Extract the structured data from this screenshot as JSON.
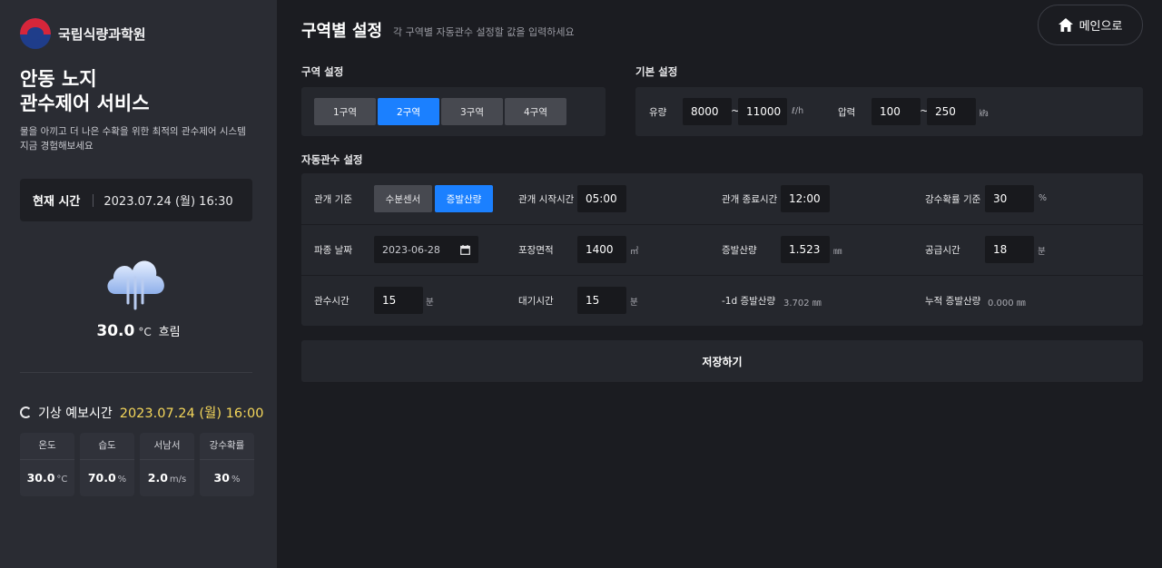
{
  "brand": {
    "name": "국립식량과학원"
  },
  "service": {
    "title_line1": "안동 노지",
    "title_line2": "관수제어 서비스",
    "desc_line1": "물을 아끼고 더 나은 수확을 위한 최적의 관수제어 시스템",
    "desc_line2": "지금 경험해보세요"
  },
  "current_time": {
    "label": "현재 시간",
    "value": "2023.07.24 (월) 16:30"
  },
  "weather": {
    "icon": "rain-cloud-icon",
    "temp": "30.0",
    "unit": "°C",
    "condition": "흐림"
  },
  "forecast": {
    "label": "기상 예보시간",
    "date": "2023.07.24 (월) 16:00",
    "stats": [
      {
        "label": "온도",
        "value": "30.0",
        "unit": "°C"
      },
      {
        "label": "습도",
        "value": "70.0",
        "unit": "%"
      },
      {
        "label": "서남서",
        "value": "2.0",
        "unit": "m/s"
      },
      {
        "label": "강수확률",
        "value": "30",
        "unit": "%"
      }
    ]
  },
  "header": {
    "title": "구역별 설정",
    "subtitle": "각 구역별 자동관수 설정할 값을 입력하세요",
    "home_label": "메인으로"
  },
  "zone": {
    "section_label": "구역 설정",
    "buttons": [
      "1구역",
      "2구역",
      "3구역",
      "4구역"
    ],
    "active": "2구역"
  },
  "basic": {
    "section_label": "기본 설정",
    "flow": {
      "label": "유량",
      "min": "8000",
      "max": "11000",
      "unit": "ℓ/h"
    },
    "pressure": {
      "label": "압력",
      "min": "100",
      "max": "250",
      "unit": "㎪"
    },
    "tilde": "~"
  },
  "auto": {
    "section_label": "자동관수 설정",
    "basis": {
      "label": "관개 기준",
      "options": [
        "수분센서",
        "증발산량"
      ],
      "active": "증발산량"
    },
    "start_time": {
      "label": "관개 시작시간",
      "value": "05:00"
    },
    "end_time": {
      "label": "관개 종료시간",
      "value": "12:00"
    },
    "rain_prob": {
      "label": "강수확률 기준",
      "value": "30",
      "unit": "%"
    },
    "sow_date": {
      "label": "파종 날짜",
      "value": "2023-06-28"
    },
    "area": {
      "label": "포장면적",
      "value": "1400",
      "unit": "㎡"
    },
    "et": {
      "label": "증발산량",
      "value": "1.523",
      "unit": "㎜"
    },
    "supply_time": {
      "label": "공급시간",
      "value": "18",
      "unit": "분"
    },
    "irrigation_time": {
      "label": "관수시간",
      "value": "15",
      "unit": "분"
    },
    "wait_time": {
      "label": "대기시간",
      "value": "15",
      "unit": "분"
    },
    "prev_et": {
      "label": "-1d 증발산량",
      "value": "3.702 ㎜"
    },
    "cum_et": {
      "label": "누적 증발산량",
      "value": "0.000 ㎜"
    }
  },
  "save_label": "저장하기"
}
